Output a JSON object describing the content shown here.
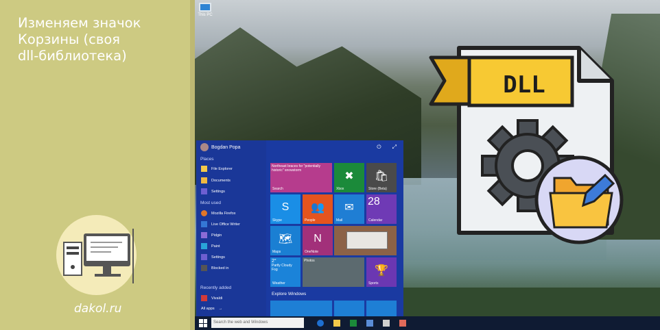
{
  "headline": {
    "line1": "Изменяем значок",
    "line2": "Корзины (своя",
    "line3": "dll-библиотека)"
  },
  "site": "dakol.ru",
  "desktop": {
    "icon_label": "This PC"
  },
  "start_menu": {
    "user": "Bogdan Popa",
    "places_label": "Places",
    "places": [
      "File Explorer",
      "Documents",
      "Settings"
    ],
    "most_used_label": "Most used",
    "most_used": [
      "Mozilla Firefox",
      "Live Office Writer",
      "Pidgin",
      "Paint",
      "Settings",
      "Blocked in"
    ],
    "recently_added_label": "Recently added",
    "recently_added": [
      "Vivaldi"
    ],
    "all_apps": "All apps",
    "tiles": {
      "news": "Northeast braces for \"potentially historic\" snowstorm",
      "search": "Search",
      "xbox": "Xbox",
      "store": "Store (Beta)",
      "skype": "Skype",
      "people": "People",
      "mail": "Mail",
      "calendar_day": "28",
      "calendar": "Calendar",
      "maps": "Maps",
      "onenote": "OneNote",
      "weather_temp": "2°",
      "weather_desc": "Partly Cloudy",
      "weather_place": "Fog",
      "weather": "Weather",
      "photos": "Photos",
      "sports": "Sports"
    },
    "explore": "Explore Windows"
  },
  "taskbar": {
    "search_placeholder": "Search the web and Windows"
  },
  "dll_label": "DLL",
  "colors": {
    "panel": "#cdca82",
    "start_menu": "#1a3aa1",
    "ribbon": "#f7c933"
  }
}
